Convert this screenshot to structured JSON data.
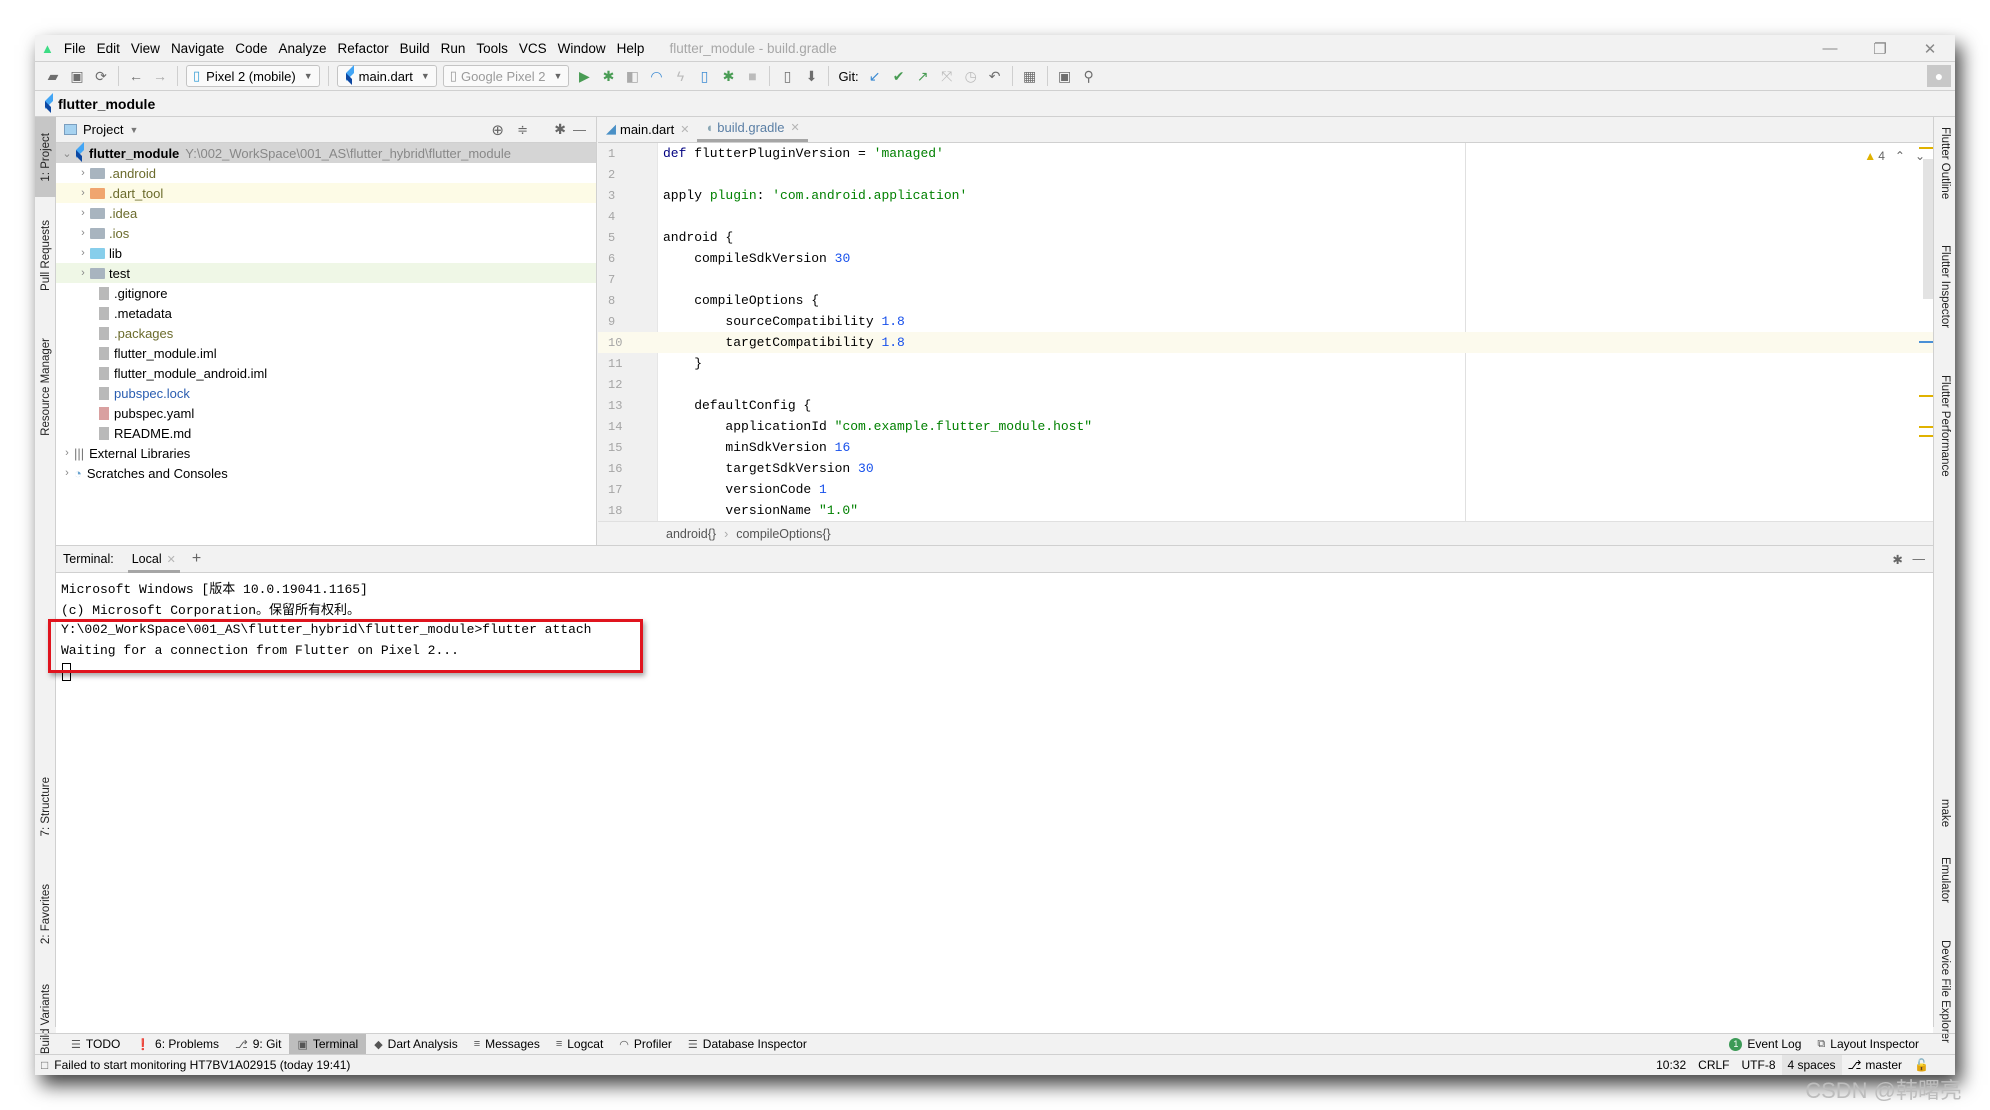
{
  "window": {
    "title": "flutter_module - build.gradle",
    "minimize_icon": "minimize-icon",
    "restore_icon": "restore-icon",
    "close_icon": "close-icon"
  },
  "menu": [
    {
      "label": "File"
    },
    {
      "label": "Edit"
    },
    {
      "label": "View"
    },
    {
      "label": "Navigate"
    },
    {
      "label": "Code"
    },
    {
      "label": "Analyze"
    },
    {
      "label": "Refactor"
    },
    {
      "label": "Build"
    },
    {
      "label": "Run"
    },
    {
      "label": "Tools"
    },
    {
      "label": "VCS"
    },
    {
      "label": "Window"
    },
    {
      "label": "Help"
    }
  ],
  "toolbar": {
    "device_target": "Pixel 2 (mobile)",
    "run_config": "main.dart",
    "device_disabled": "Google Pixel 2",
    "git_label": "Git:"
  },
  "navbar": {
    "project": "flutter_module"
  },
  "left_strip": {
    "project": "1: Project",
    "pull_requests": "Pull Requests",
    "resource_manager": "Resource Manager",
    "structure": "7: Structure",
    "favorites": "2: Favorites",
    "build_variants": "Build Variants"
  },
  "right_strip": {
    "outline": "Flutter Outline",
    "inspector": "Flutter Inspector",
    "performance": "Flutter Performance",
    "make": "make",
    "emulator": "Emulator",
    "device_file_explorer": "Device File Explorer"
  },
  "project": {
    "header": "Project",
    "root": {
      "name": "flutter_module",
      "path": "Y:\\002_WorkSpace\\001_AS\\flutter_hybrid\\flutter_module"
    },
    "items": [
      {
        "name": ".android",
        "type": "folder",
        "expandable": true
      },
      {
        "name": ".dart_tool",
        "type": "folder-excluded",
        "expandable": true
      },
      {
        "name": ".idea",
        "type": "folder",
        "expandable": true
      },
      {
        "name": ".ios",
        "type": "folder",
        "expandable": true
      },
      {
        "name": "lib",
        "type": "folder-source",
        "expandable": true
      },
      {
        "name": "test",
        "type": "folder-test",
        "expandable": true
      },
      {
        "name": ".gitignore",
        "type": "file"
      },
      {
        "name": ".metadata",
        "type": "file"
      },
      {
        "name": ".packages",
        "type": "file"
      },
      {
        "name": "flutter_module.iml",
        "type": "file"
      },
      {
        "name": "flutter_module_android.iml",
        "type": "file"
      },
      {
        "name": "pubspec.lock",
        "type": "file"
      },
      {
        "name": "pubspec.yaml",
        "type": "file"
      },
      {
        "name": "README.md",
        "type": "file"
      }
    ],
    "extra": [
      "External Libraries",
      "Scratches and Consoles"
    ]
  },
  "editor": {
    "tabs": [
      {
        "label": "main.dart",
        "active": false
      },
      {
        "label": "build.gradle",
        "active": true
      }
    ],
    "warnings_count": "4",
    "current_line": 10,
    "lines": [
      "def flutterPluginVersion = 'managed'",
      "",
      "apply plugin: 'com.android.application'",
      "",
      "android {",
      "    compileSdkVersion 30",
      "",
      "    compileOptions {",
      "        sourceCompatibility 1.8",
      "        targetCompatibility 1.8",
      "    }",
      "",
      "    defaultConfig {",
      "        applicationId \"com.example.flutter_module.host\"",
      "        minSdkVersion 16",
      "        targetSdkVersion 30",
      "        versionCode 1",
      "        versionName \"1.0\""
    ],
    "breadcrumbs": [
      "android{}",
      "compileOptions{}"
    ]
  },
  "terminal": {
    "label": "Terminal:",
    "tab": "Local",
    "lines": [
      "Microsoft Windows [版本 10.0.19041.1165]",
      "(c) Microsoft Corporation。保留所有权利。",
      "Y:\\002_WorkSpace\\001_AS\\flutter_hybrid\\flutter_module>flutter attach",
      "Waiting for a connection from Flutter on Pixel 2..."
    ]
  },
  "bottom_tools": [
    {
      "label": "TODO",
      "icon": "list-icon"
    },
    {
      "label": "6: Problems",
      "icon": "problems-icon"
    },
    {
      "label": "9: Git",
      "icon": "git-icon"
    },
    {
      "label": "Terminal",
      "icon": "terminal-icon",
      "active": true
    },
    {
      "label": "Dart Analysis",
      "icon": "dart-icon"
    },
    {
      "label": "Messages",
      "icon": "messages-icon"
    },
    {
      "label": "Logcat",
      "icon": "logcat-icon"
    },
    {
      "label": "Profiler",
      "icon": "profiler-icon"
    },
    {
      "label": "Database Inspector",
      "icon": "database-icon"
    }
  ],
  "bottom_tools_right": {
    "event_log": "Event Log",
    "event_count": "1",
    "layout_inspector": "Layout Inspector"
  },
  "status": {
    "message": "Failed to start monitoring HT7BV1A02915 (today 19:41)",
    "position": "10:32",
    "line_sep": "CRLF",
    "encoding": "UTF-8",
    "indent": "4 spaces",
    "branch": "master"
  },
  "watermark": "CSDN @韩曙亮",
  "colors": {
    "accent_red": "#e0141e",
    "flutter_blue": "#42a5f5",
    "run_green": "#499c54"
  }
}
